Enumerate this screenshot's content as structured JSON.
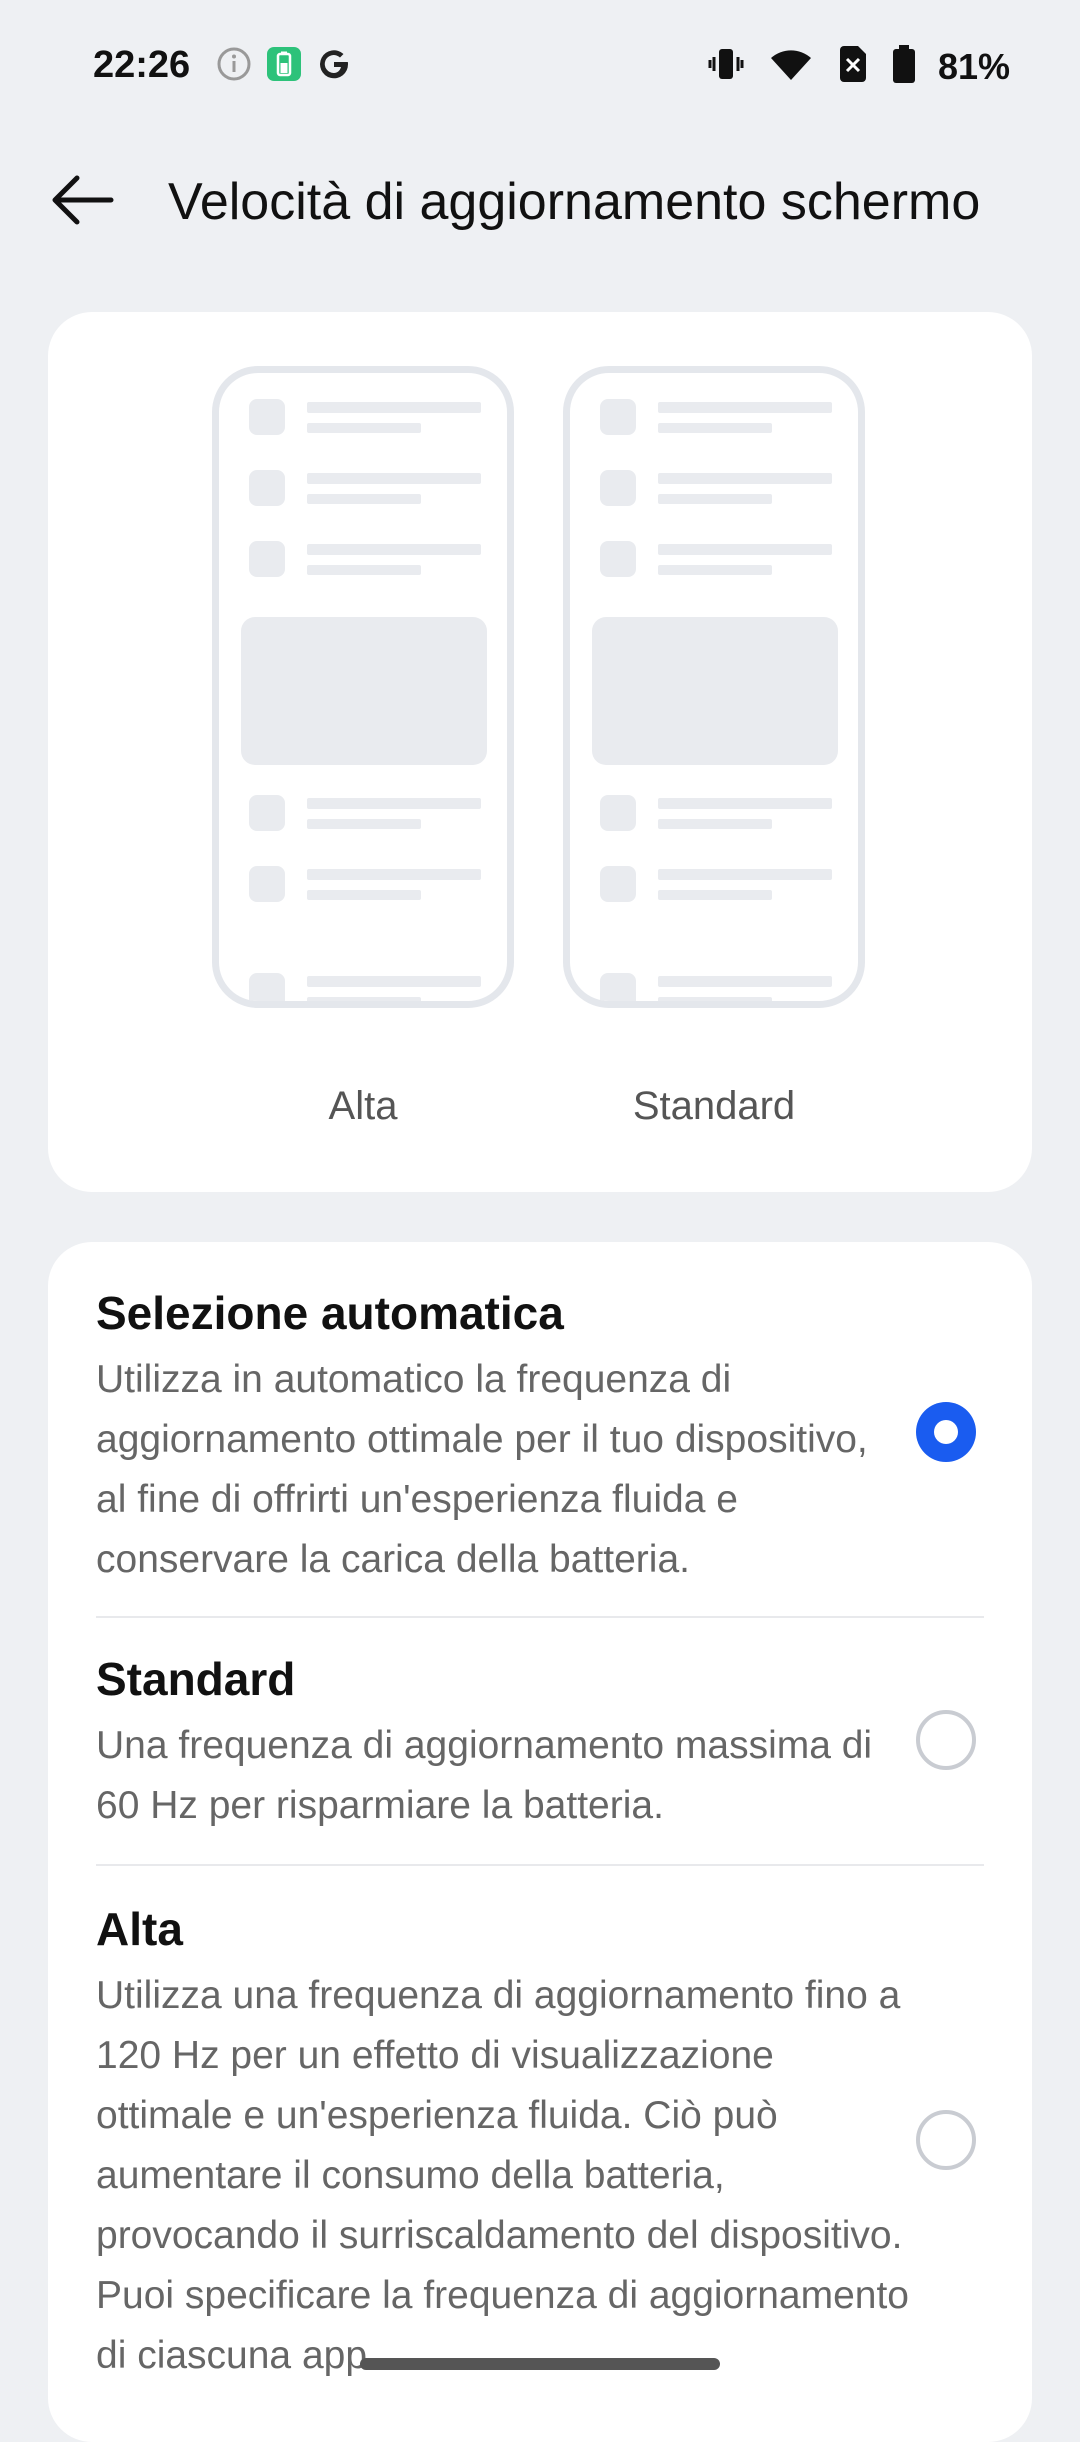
{
  "status_bar": {
    "time": "22:26",
    "battery_percent": "81%",
    "left_icons": [
      "info-icon",
      "battery-saver-icon",
      "google-icon"
    ],
    "right_icons": [
      "vibrate-icon",
      "wifi-icon",
      "no-sim-icon",
      "battery-icon"
    ]
  },
  "header": {
    "title": "Velocità di aggiornamento schermo",
    "back_icon": "arrow-left-icon"
  },
  "preview": {
    "left_label": "Alta",
    "right_label": "Standard"
  },
  "options": [
    {
      "title": "Selezione automatica",
      "description": "Utilizza in automatico la frequenza di aggiornamento ottimale per il tuo dispositivo, al fine di offrirti un'esperienza fluida e conservare la carica della batteria.",
      "selected": true
    },
    {
      "title": "Standard",
      "description": "Una frequenza di aggiornamento massima di 60 Hz per risparmiare la batteria.",
      "selected": false
    },
    {
      "title": "Alta",
      "description": "Utilizza una frequenza di aggiornamento fino a 120 Hz per un effetto di visualizzazione ottimale e un'esperienza fluida. Ciò può aumentare il consumo della batteria, provocando il surriscaldamento del dispositivo. Puoi specificare la frequenza di aggiornamento di ciascuna app.",
      "selected": false
    }
  ],
  "colors": {
    "accent": "#1a5cf0",
    "background": "#eef0f3",
    "card": "#ffffff"
  }
}
